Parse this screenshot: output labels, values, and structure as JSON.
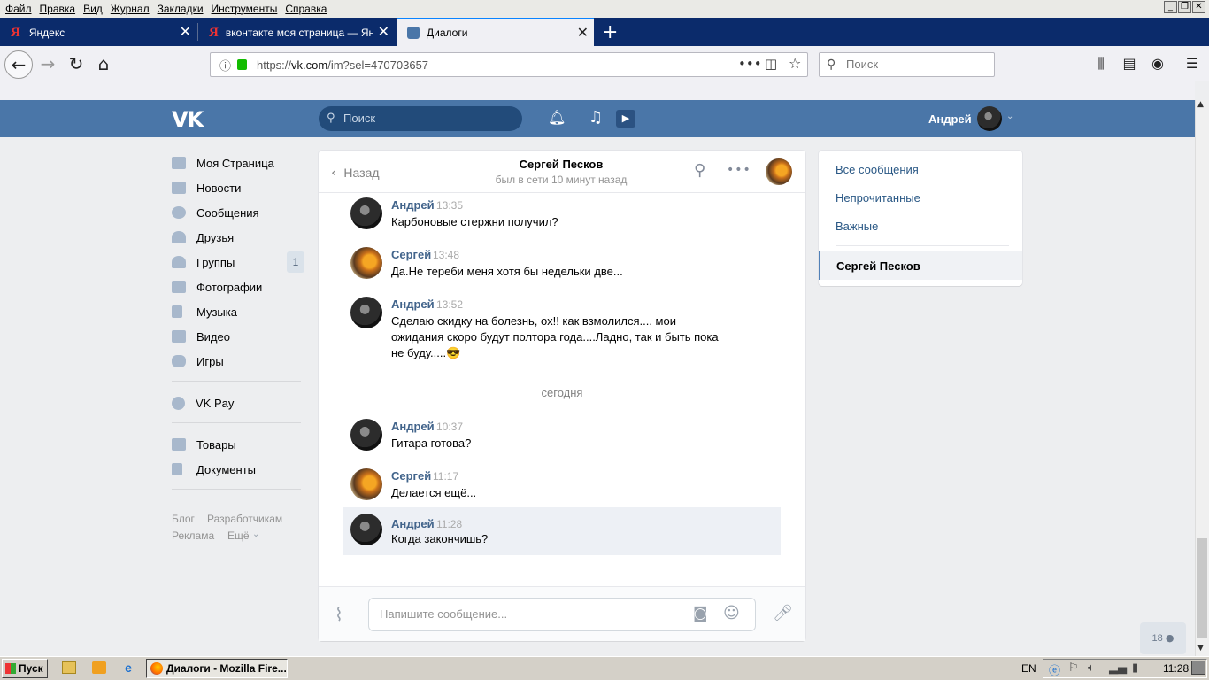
{
  "menubar": {
    "items": [
      "Файл",
      "Правка",
      "Вид",
      "Журнал",
      "Закладки",
      "Инструменты",
      "Справка"
    ]
  },
  "tabs": [
    {
      "title": "Яндекс",
      "icon": "yandex-icon",
      "active": false
    },
    {
      "title": "вконтакте моя страница — Янд",
      "icon": "yandex-icon",
      "active": false
    },
    {
      "title": "Диалоги",
      "icon": "vk-chat-icon",
      "active": true
    }
  ],
  "urlbar": {
    "prefix": "https://",
    "host": "vk.com",
    "path": "/im?sel=470703657"
  },
  "searchbar": {
    "placeholder": "Поиск"
  },
  "vk": {
    "logo": "VK",
    "search_placeholder": "Поиск",
    "user_name": "Андрей"
  },
  "left_menu": [
    {
      "label": "Моя Страница",
      "icon": "home-icon"
    },
    {
      "label": "Новости",
      "icon": "news-icon"
    },
    {
      "label": "Сообщения",
      "icon": "messages-icon"
    },
    {
      "label": "Друзья",
      "icon": "friends-icon"
    },
    {
      "label": "Группы",
      "icon": "groups-icon",
      "badge": "1"
    },
    {
      "label": "Фотографии",
      "icon": "camera-icon"
    },
    {
      "label": "Музыка",
      "icon": "music-icon"
    },
    {
      "label": "Видео",
      "icon": "video-icon"
    },
    {
      "label": "Игры",
      "icon": "gamepad-icon"
    }
  ],
  "left_menu_pay": {
    "label": "VK Pay",
    "icon": "vkpay-icon"
  },
  "left_menu_extra": [
    {
      "label": "Товары",
      "icon": "bag-icon"
    },
    {
      "label": "Документы",
      "icon": "document-icon"
    }
  ],
  "footer_links": [
    "Блог",
    "Разработчикам",
    "Реклама",
    "Ещё"
  ],
  "chat": {
    "back_label": "Назад",
    "peer_name": "Сергей Песков",
    "peer_status": "был в сети 10 минут назад",
    "day_divider": "сегодня",
    "input_placeholder": "Напишите сообщение...",
    "messages": [
      {
        "author": "Андрей",
        "time": "13:35",
        "text": "Карбоновые стержни получил?",
        "avatar": "andrey"
      },
      {
        "author": "Сергей",
        "time": "13:48",
        "text": "Да.Не тереби меня хотя бы недельки две...",
        "avatar": "sergey"
      },
      {
        "author": "Андрей",
        "time": "13:52",
        "text": "Сделаю скидку на болезнь, ох!! как взмолился.... мои ожидания скоро будут полтора года....Ладно, так и быть пока не буду.....😎",
        "avatar": "andrey"
      },
      {
        "author": "Андрей",
        "time": "10:37",
        "text": "Гитара готова?",
        "avatar": "andrey"
      },
      {
        "author": "Сергей",
        "time": "11:17",
        "text": "Делается ещё...",
        "avatar": "sergey"
      },
      {
        "author": "Андрей",
        "time": "11:28",
        "text": "Когда закончишь?",
        "avatar": "andrey",
        "highlighted": true
      }
    ]
  },
  "right_panel": {
    "items": [
      "Все сообщения",
      "Непрочитанные",
      "Важные"
    ],
    "selected": "Сергей Песков"
  },
  "online_count": "18",
  "taskbar": {
    "start": "Пуск",
    "task": "Диалоги - Mozilla Fire...",
    "lang": "EN",
    "clock": "11:28"
  },
  "colors": {
    "vk_header": "#4a76a8",
    "vk_link": "#2a5885",
    "firefox_tabstrip": "#0b2b6b"
  }
}
